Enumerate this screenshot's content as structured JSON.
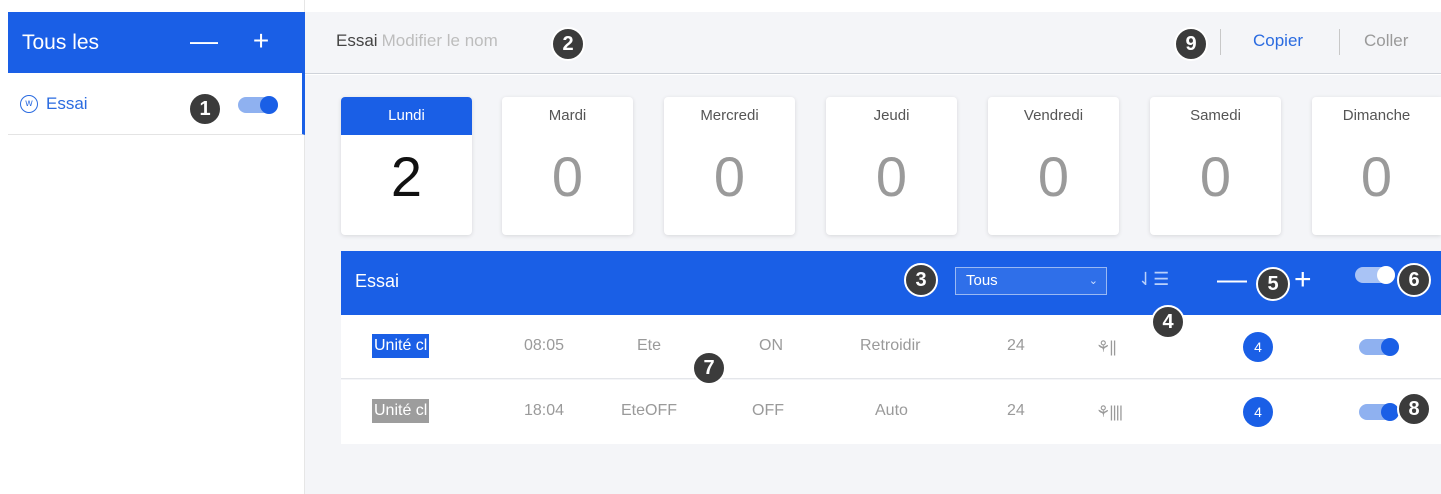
{
  "sidebar": {
    "title": "Tous les",
    "minus": "—",
    "plus": "+",
    "item": {
      "icon": "wifi-circle-icon",
      "label": "Essai",
      "enabled": true
    }
  },
  "topbar": {
    "name": "Essai",
    "rename": "Modifier le nom",
    "copy": "Copier",
    "paste": "Coller"
  },
  "days": [
    {
      "name": "Lundi",
      "count": "2",
      "active": true
    },
    {
      "name": "Mardi",
      "count": "0"
    },
    {
      "name": "Mercredi",
      "count": "0"
    },
    {
      "name": "Jeudi",
      "count": "0"
    },
    {
      "name": "Vendredi",
      "count": "0"
    },
    {
      "name": "Samedi",
      "count": "0"
    },
    {
      "name": "Dimanche",
      "count": "0"
    }
  ],
  "panel": {
    "title": "Essai",
    "filter": "Tous",
    "filter_chevron": "⌄",
    "sort_icon": "⇃☰",
    "minus": "—",
    "plus": "+",
    "enabled": true
  },
  "rows": [
    {
      "unit": "Unité cl",
      "time": "08:05",
      "season": "Ete",
      "power": "ON",
      "mode": "Retroidir",
      "temp": "24",
      "fan": "⚘||",
      "count": "4",
      "enabled": true
    },
    {
      "unit": "Unité cl",
      "time": "18:04",
      "season": "EteOFF",
      "power": "OFF",
      "mode": "Auto",
      "temp": "24",
      "fan": "⚘||||",
      "count": "4",
      "enabled": true
    }
  ],
  "badges": [
    "1",
    "2",
    "3",
    "4",
    "5",
    "6",
    "7",
    "8",
    "9"
  ],
  "colors": {
    "accent": "#1a5fe6",
    "badge": "#3b3b3b",
    "background": "#f4f5f8"
  }
}
